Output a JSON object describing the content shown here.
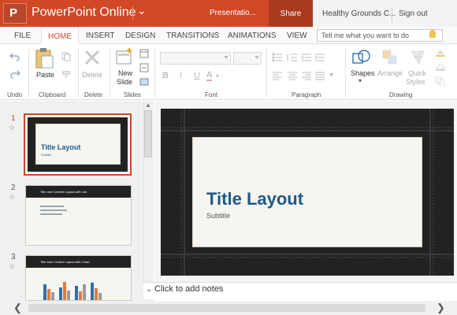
{
  "titlebar": {
    "logo_letter": "P",
    "app_name": "PowerPoint Online",
    "doc_name": "Presentatio...",
    "share_label": "Share",
    "location": "Healthy Grounds C...",
    "signout_label": "Sign out",
    "accent_color": "#d24726"
  },
  "tabs": [
    "FILE",
    "HOME",
    "INSERT",
    "DESIGN",
    "TRANSITIONS",
    "ANIMATIONS",
    "VIEW"
  ],
  "active_tab": "HOME",
  "tellme_placeholder": "Tell me what you want to do",
  "ribbon": {
    "groups": {
      "undo": "Undo",
      "clipboard": "Clipboard",
      "delete": "Delete",
      "slides": "Slides",
      "font": "Font",
      "paragraph": "Paragraph",
      "drawing": "Drawing"
    },
    "paste_label": "Paste",
    "delete_label": "Delete",
    "new_slide_label_1": "New",
    "new_slide_label_2": "Slide",
    "shapes_label": "Shapes",
    "arrange_label": "Arrange",
    "quick_styles_label_1": "Quick",
    "quick_styles_label_2": "Styles",
    "font_bold": "B",
    "font_italic": "I",
    "font_underline": "U",
    "font_color": "A"
  },
  "slides": [
    {
      "number": "1",
      "title": "Title Layout",
      "subtitle": "Subtitle"
    },
    {
      "number": "2",
      "title": "Title and Content Layout with List"
    },
    {
      "number": "3",
      "title": "Title and Content Layout with Chart"
    }
  ],
  "main_slide": {
    "title": "Title Layout",
    "subtitle": "Subtitle"
  },
  "notes_placeholder": "Click to add notes"
}
